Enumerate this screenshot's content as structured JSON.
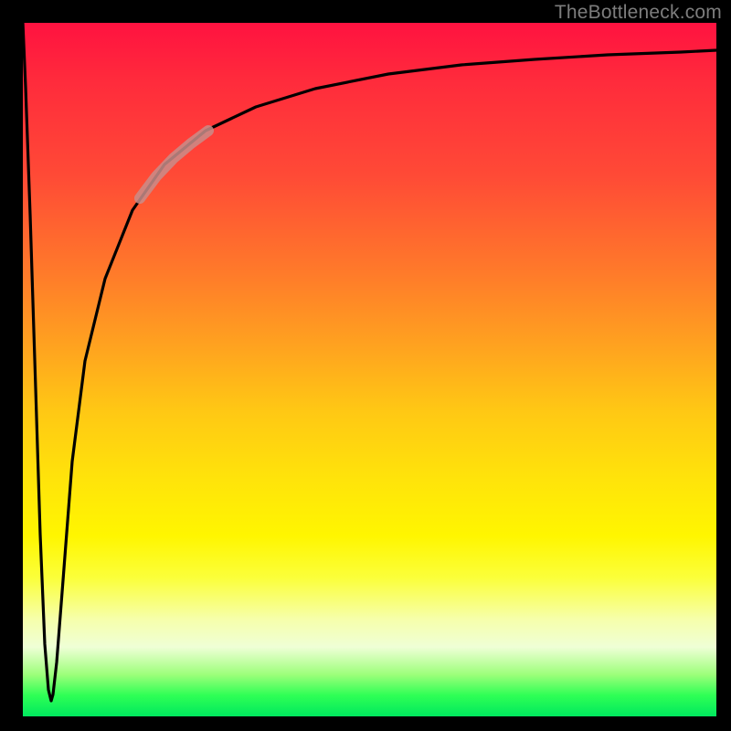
{
  "watermark": {
    "text": "TheBottleneck.com"
  },
  "colors": {
    "page_bg": "#000000",
    "curve_stroke": "#000000",
    "highlight_stroke": "#c98d8a",
    "watermark_text": "#7d7d7d"
  },
  "chart_data": {
    "type": "line",
    "title": "",
    "xlabel": "",
    "ylabel": "",
    "xlim": [
      0,
      100
    ],
    "ylim": [
      0,
      100
    ],
    "grid": false,
    "legend": false,
    "note": "No axis ticks or numeric labels are rendered. Values are estimated from pixel position relative to plot extents; y is shown with 0 at bottom (green) and 100 at top (red).",
    "series": [
      {
        "name": "main-curve",
        "stroke": "#000000",
        "x": [
          0.0,
          0.5,
          1.2,
          2.0,
          2.7,
          3.3,
          3.9,
          4.2,
          4.5,
          5.0,
          6.0,
          7.5,
          10.0,
          13.0,
          17.0,
          22.0,
          28.0,
          35.0,
          45.0,
          55.0,
          65.0,
          75.0,
          85.0,
          95.0,
          100.0
        ],
        "y": [
          100.0,
          85.0,
          60.0,
          35.0,
          15.0,
          5.0,
          2.5,
          3.0,
          8.0,
          20.0,
          38.0,
          52.0,
          64.0,
          72.5,
          78.5,
          83.0,
          86.5,
          89.0,
          91.5,
          93.2,
          94.3,
          95.1,
          95.7,
          96.1,
          96.3
        ]
      },
      {
        "name": "highlight-segment",
        "stroke": "#c98d8a",
        "x": [
          17.0,
          19.5,
          22.0,
          24.5,
          27.0
        ],
        "y": [
          78.5,
          81.0,
          83.0,
          84.8,
          86.2
        ]
      }
    ]
  }
}
